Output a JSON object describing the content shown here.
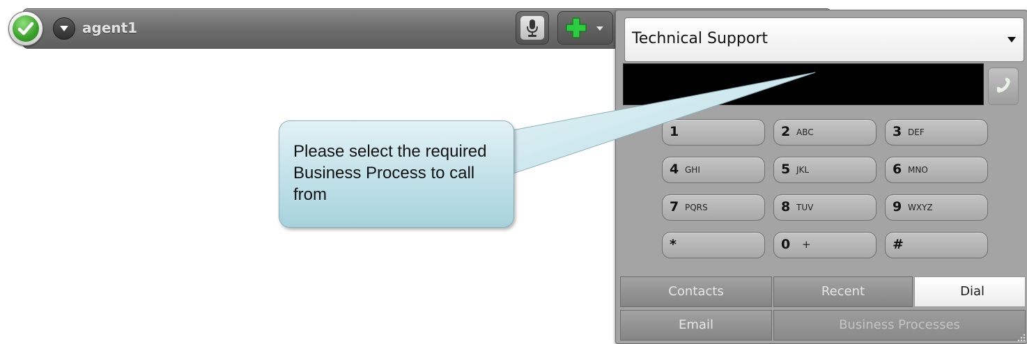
{
  "agent": {
    "name": "agent1",
    "status_icon": "check-icon",
    "status_color": "#3aa02a"
  },
  "toolbar": {
    "mic_icon": "microphone-icon",
    "add_icon": "plus-icon",
    "add_color": "#2ecc40"
  },
  "dial": {
    "business_process": "Technical Support",
    "number_value": "",
    "keys": [
      {
        "digit": "1",
        "letters": ""
      },
      {
        "digit": "2",
        "letters": "ABC"
      },
      {
        "digit": "3",
        "letters": "DEF"
      },
      {
        "digit": "4",
        "letters": "GHI"
      },
      {
        "digit": "5",
        "letters": "JKL"
      },
      {
        "digit": "6",
        "letters": "MNO"
      },
      {
        "digit": "7",
        "letters": "PQRS"
      },
      {
        "digit": "8",
        "letters": "TUV"
      },
      {
        "digit": "9",
        "letters": "WXYZ"
      },
      {
        "digit": "*",
        "letters": ""
      },
      {
        "digit": "0",
        "letters": "+"
      },
      {
        "digit": "#",
        "letters": ""
      }
    ],
    "tabs": {
      "contacts": "Contacts",
      "recent": "Recent",
      "dial": "Dial",
      "email": "Email",
      "business_processes": "Business Processes"
    },
    "active_tab": "Dial"
  },
  "callout": {
    "text": "Please select the required Business Process to call from"
  }
}
